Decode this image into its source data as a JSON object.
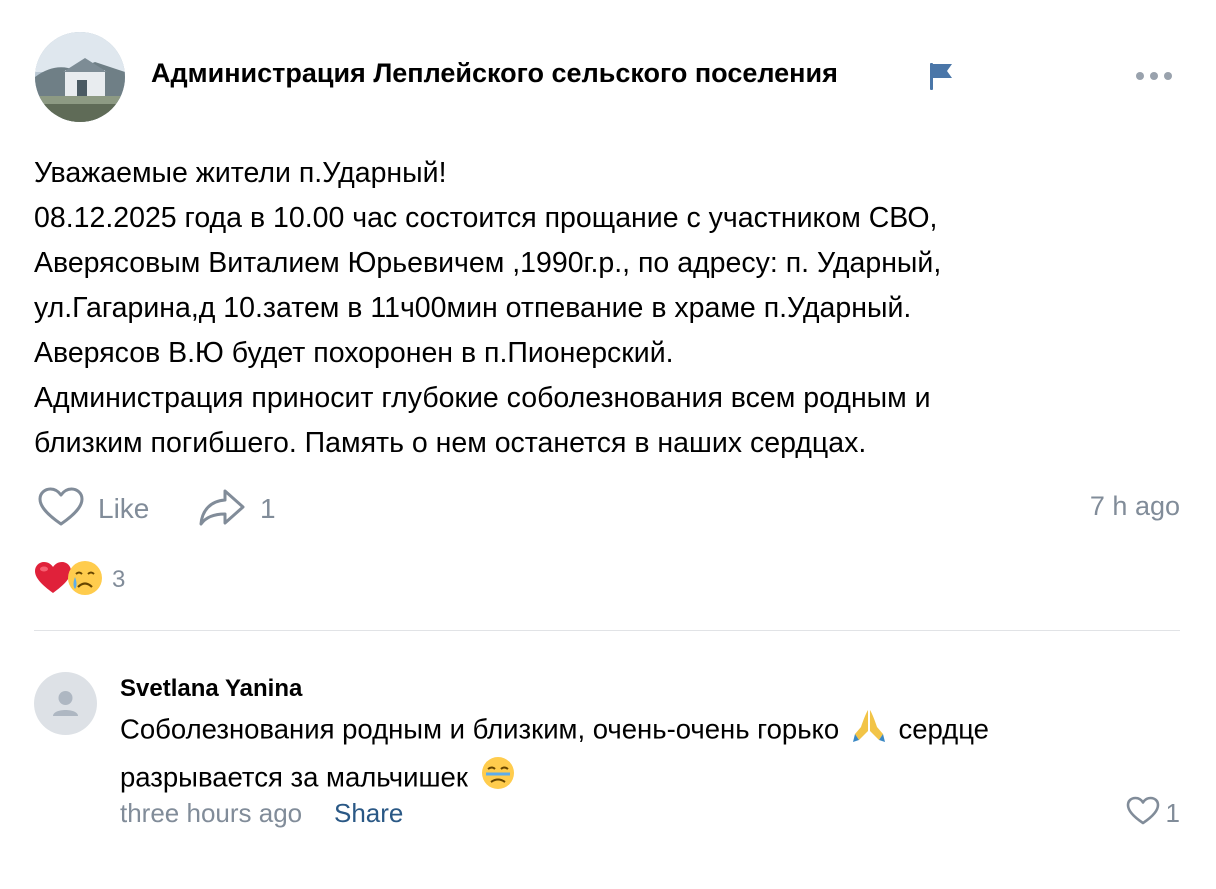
{
  "post": {
    "group_name": "Администрация Леплейского сельского поселения",
    "lines": [
      "Уважаемые жители п.Ударный!",
      "08.12.2025 года в 10.00 час состоится прощание с участником СВО,",
      "Аверясовым Виталием Юрьевичем ,1990г.р., по адресу: п. Ударный,",
      "ул.Гагарина,д 10.затем в 11ч00мин отпевание в храме п.Ударный.",
      "Аверясов В.Ю будет похоронен в п.Пионерский.",
      "Администрация приносит глубокие соболезнования всем родным и",
      "близким погибшего. Память о нем останется в наших сердцах."
    ],
    "like_label": "Like",
    "share_count": "1",
    "time": "7 h ago",
    "reactions_count": "3"
  },
  "comment": {
    "author": "Svetlana Yanina",
    "line1_before": "Соболезнования родным и близким, очень-очень горько",
    "line1_after": "сердце",
    "line2": "разрывается за мальчишек",
    "time": "three hours ago",
    "share_label": "Share",
    "like_count": "1"
  },
  "icons": {
    "flag": "flag-icon",
    "more": "more-icon",
    "like": "heart-outline-icon",
    "share": "share-arrow-icon",
    "reaction_heart": "heart-reaction-icon",
    "reaction_crying": "crying-face-icon",
    "comment_avatar": "user-placeholder-icon",
    "pray": "folded-hands-emoji",
    "sad": "sad-face-emoji"
  },
  "colors": {
    "secondary_text": "#818c99",
    "link": "#2a5885",
    "flag": "#4a76a8",
    "divider": "#e1e3e6"
  }
}
